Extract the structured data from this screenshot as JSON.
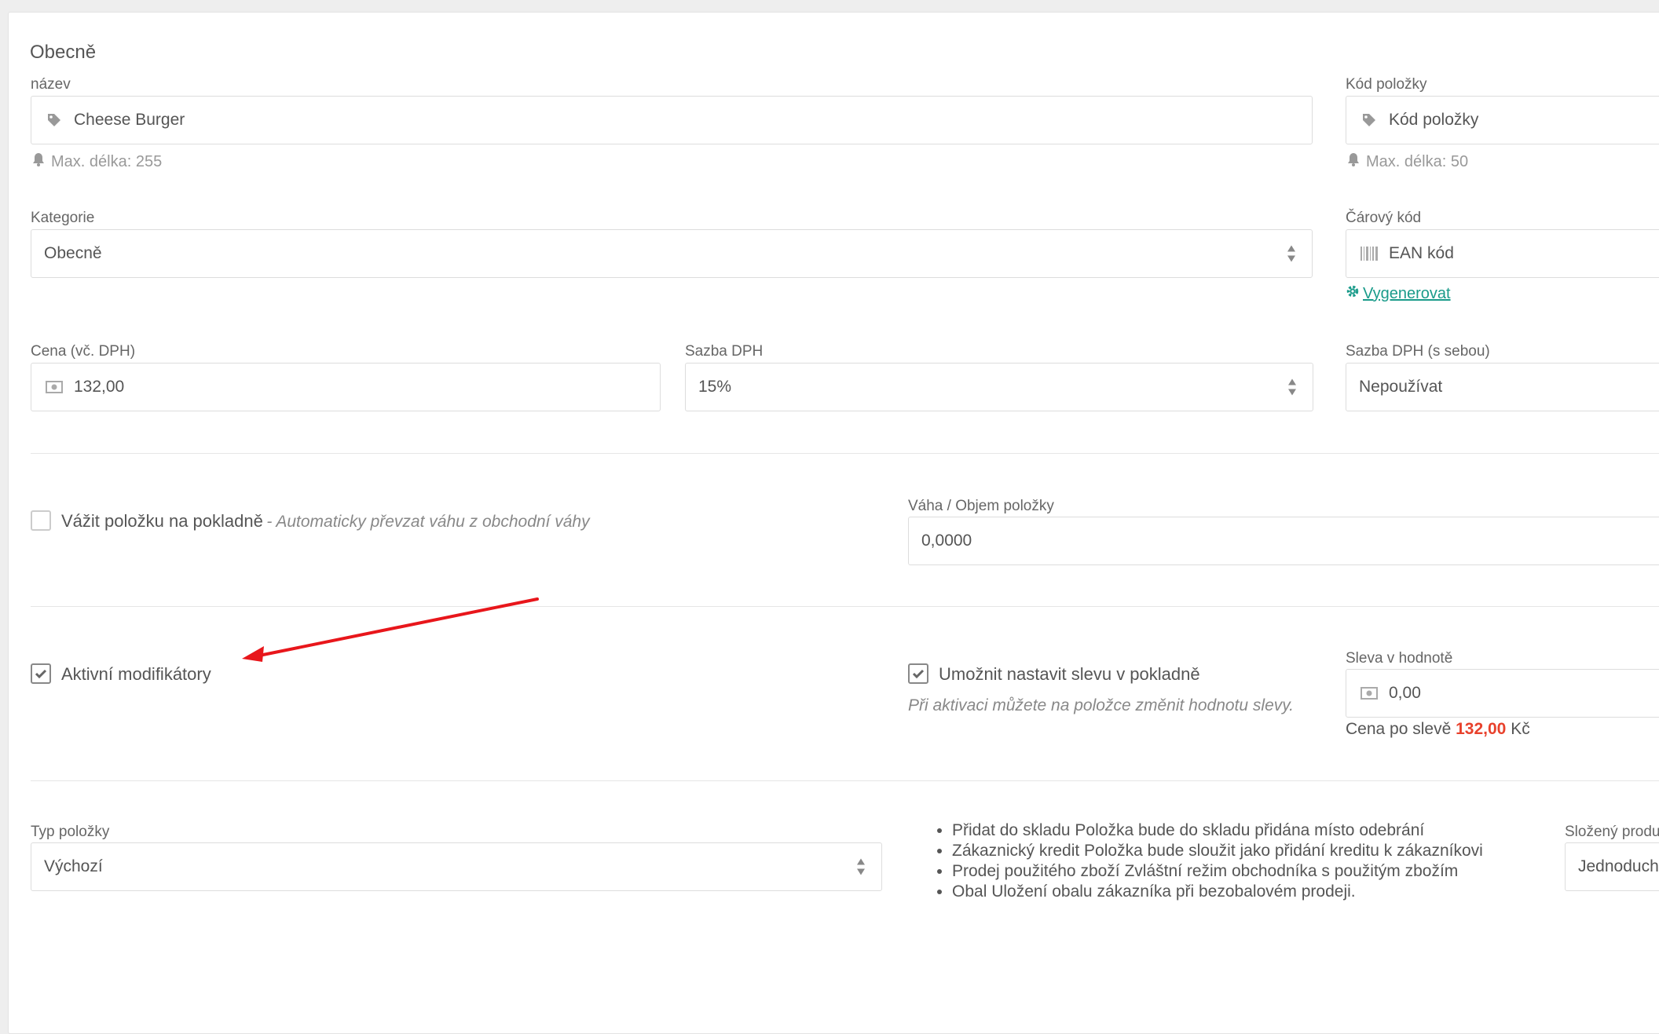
{
  "section_title": "Obecně",
  "name": {
    "label": "název",
    "value": "Cheese Burger",
    "help": "Max. délka: 255"
  },
  "code": {
    "label": "Kód položky",
    "placeholder": "Kód položky",
    "help": "Max. délka: 50"
  },
  "category": {
    "label": "Kategorie",
    "value": "Obecně"
  },
  "barcode": {
    "label": "Čárový kód",
    "placeholder": "EAN kód",
    "generate_link": "Vygenerovat"
  },
  "price": {
    "label": "Cena (vč. DPH)",
    "value": "132,00"
  },
  "vat": {
    "label": "Sazba DPH",
    "value": "15%"
  },
  "vat_takeaway": {
    "label": "Sazba DPH (s sebou)",
    "value": "Nepoužívat"
  },
  "weigh": {
    "label": "Vážit položku na pokladně",
    "hint": "- Automaticky převzat váhu z obchodní váhy",
    "checked": false
  },
  "weight": {
    "label": "Váha / Objem položky",
    "value": "0,0000"
  },
  "modifiers": {
    "label": "Aktivní modifikátory",
    "checked": true
  },
  "discount_allow": {
    "label": "Umožnit nastavit slevu v pokladně",
    "hint": "Při aktivaci můžete na položce změnit hodnotu slevy.",
    "checked": true
  },
  "discount_value": {
    "label": "Sleva v hodnotě",
    "value": "0,00",
    "after_prefix": "Cena po slevě",
    "after_value": "132,00",
    "after_suffix": "Kč"
  },
  "item_type": {
    "label": "Typ položky",
    "value": "Výchozí"
  },
  "type_notes": [
    "Přidat do skladu Položka bude do skladu přidána místo odebrání",
    "Zákaznický kredit Položka bude sloužit jako přidání kreditu k zákazníkovi",
    "Prodej použitého zboží Zvláštní režim obchodníka s použitým zbožím",
    "Obal Uložení obalu zákazníka při bezobalovém prodeji."
  ],
  "composite": {
    "label": "Složený produ",
    "value": "Jednoduch"
  },
  "colors": {
    "accent": "#1a9b8a",
    "danger": "#e8412c",
    "annotation_arrow": "#e8161b"
  },
  "icons": {
    "tag": "tag-icon",
    "bell": "bell-icon",
    "barcode": "barcode-icon",
    "gear": "gear-icon",
    "money": "money-icon",
    "check": "check-icon",
    "arrows": "select-arrows-icon"
  }
}
